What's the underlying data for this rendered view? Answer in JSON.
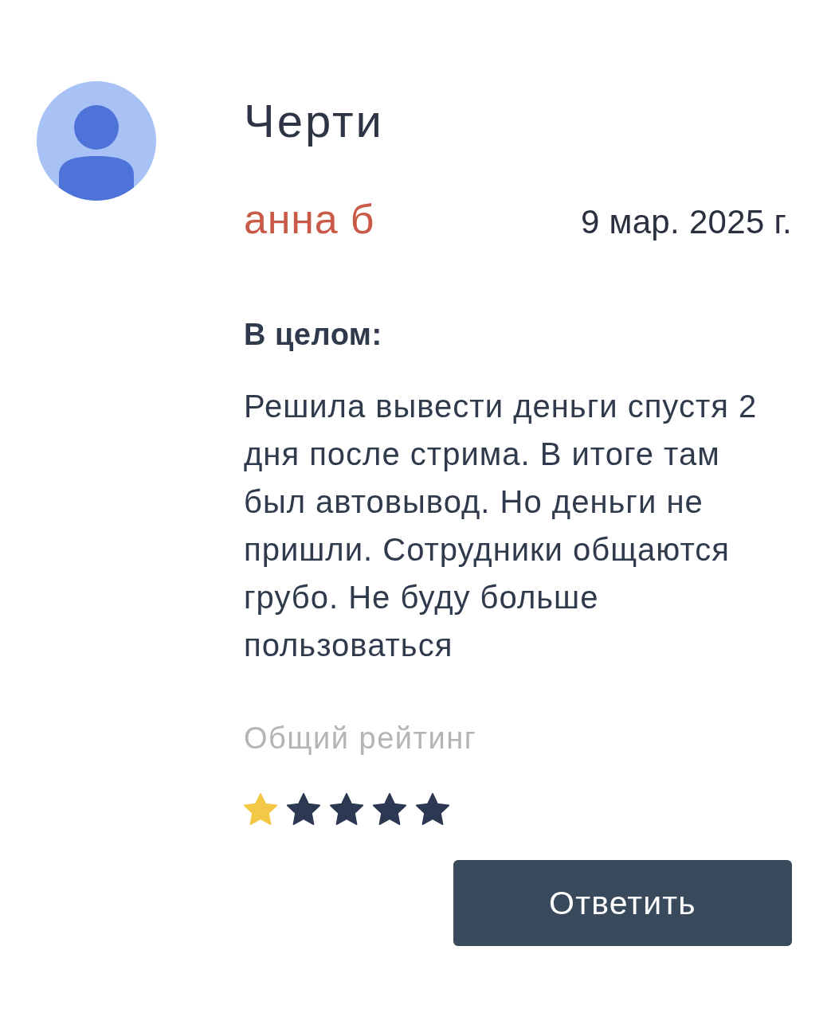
{
  "review": {
    "title": "Черти",
    "author": "анна б",
    "date": "9 мар. 2025 г.",
    "section_heading": "В целом:",
    "body": "Решила вывести деньги спустя 2 дня после стрима. В итоге там был автовывод. Но деньги не пришли. Сотрудники общаются грубо. Не буду больше пользоваться",
    "rating": {
      "label": "Общий рейтинг",
      "stars": 1
    },
    "reply_button": "Ответить"
  }
}
